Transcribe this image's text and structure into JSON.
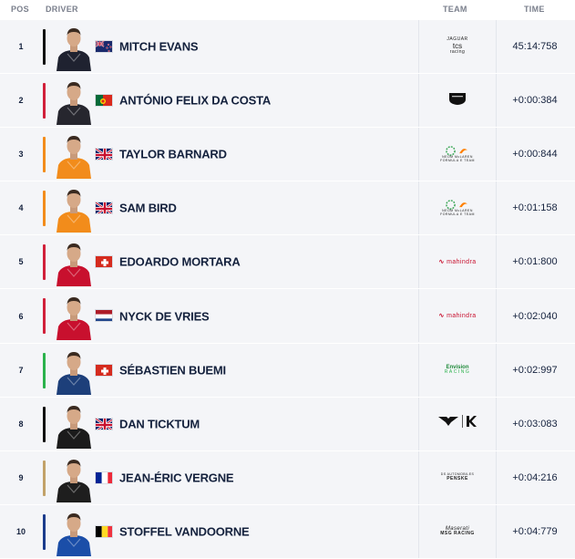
{
  "header": {
    "pos": "POS",
    "driver": "DRIVER",
    "team": "TEAM",
    "time": "TIME"
  },
  "rows": [
    {
      "pos": "1",
      "name": "MITCH EVANS",
      "time": "45:14:758",
      "flag": "new-zealand",
      "team": "jaguar",
      "team_text": [
        "JAGUAR",
        "tcs",
        "racing"
      ],
      "bar": "#111111",
      "suit": "#1f2230"
    },
    {
      "pos": "2",
      "name": "ANTÓNIO FELIX DA COSTA",
      "time": "+0:00:384",
      "flag": "portugal",
      "team": "porsche",
      "team_text": [],
      "bar": "#d1203a",
      "suit": "#26262e"
    },
    {
      "pos": "3",
      "name": "TAYLOR BARNARD",
      "time": "+0:00:844",
      "flag": "united-kingdom",
      "team": "neom-mclaren",
      "team_text": [
        "NEOM McLAREN",
        "FORMULA E TEAM"
      ],
      "bar": "#f28c1b",
      "suit": "#f28c1b"
    },
    {
      "pos": "4",
      "name": "SAM BIRD",
      "time": "+0:01:158",
      "flag": "united-kingdom",
      "team": "neom-mclaren",
      "team_text": [
        "NEOM McLAREN",
        "FORMULA E TEAM"
      ],
      "bar": "#f28c1b",
      "suit": "#f28c1b"
    },
    {
      "pos": "5",
      "name": "EDOARDO MORTARA",
      "time": "+0:01:800",
      "flag": "switzerland",
      "team": "mahindra",
      "team_text": [
        "mahindra"
      ],
      "bar": "#d1203a",
      "suit": "#c8102e"
    },
    {
      "pos": "6",
      "name": "NYCK DE VRIES",
      "time": "+0:02:040",
      "flag": "netherlands",
      "team": "mahindra",
      "team_text": [
        "mahindra"
      ],
      "bar": "#d1203a",
      "suit": "#c8102e"
    },
    {
      "pos": "7",
      "name": "SÉBASTIEN BUEMI",
      "time": "+0:02:997",
      "flag": "switzerland",
      "team": "envision",
      "team_text": [
        "Envision",
        "RACING"
      ],
      "bar": "#2bb24c",
      "suit": "#1d3f7a"
    },
    {
      "pos": "8",
      "name": "DAN TICKTUM",
      "time": "+0:03:083",
      "flag": "united-kingdom",
      "team": "cupra-kiro",
      "team_text": [],
      "bar": "#111111",
      "suit": "#1b1b1b"
    },
    {
      "pos": "9",
      "name": "JEAN-ÉRIC VERGNE",
      "time": "+0:04:216",
      "flag": "france",
      "team": "ds-penske",
      "team_text": [
        "DS AUTOMOBILES",
        "PENSKE"
      ],
      "bar": "#c2a269",
      "suit": "#1e1e1e"
    },
    {
      "pos": "10",
      "name": "STOFFEL VANDOORNE",
      "time": "+0:04:779",
      "flag": "belgium",
      "team": "maserati",
      "team_text": [
        "Maserati",
        "MSG RACING"
      ],
      "bar": "#1b3c8c",
      "suit": "#1b4ea8"
    }
  ]
}
